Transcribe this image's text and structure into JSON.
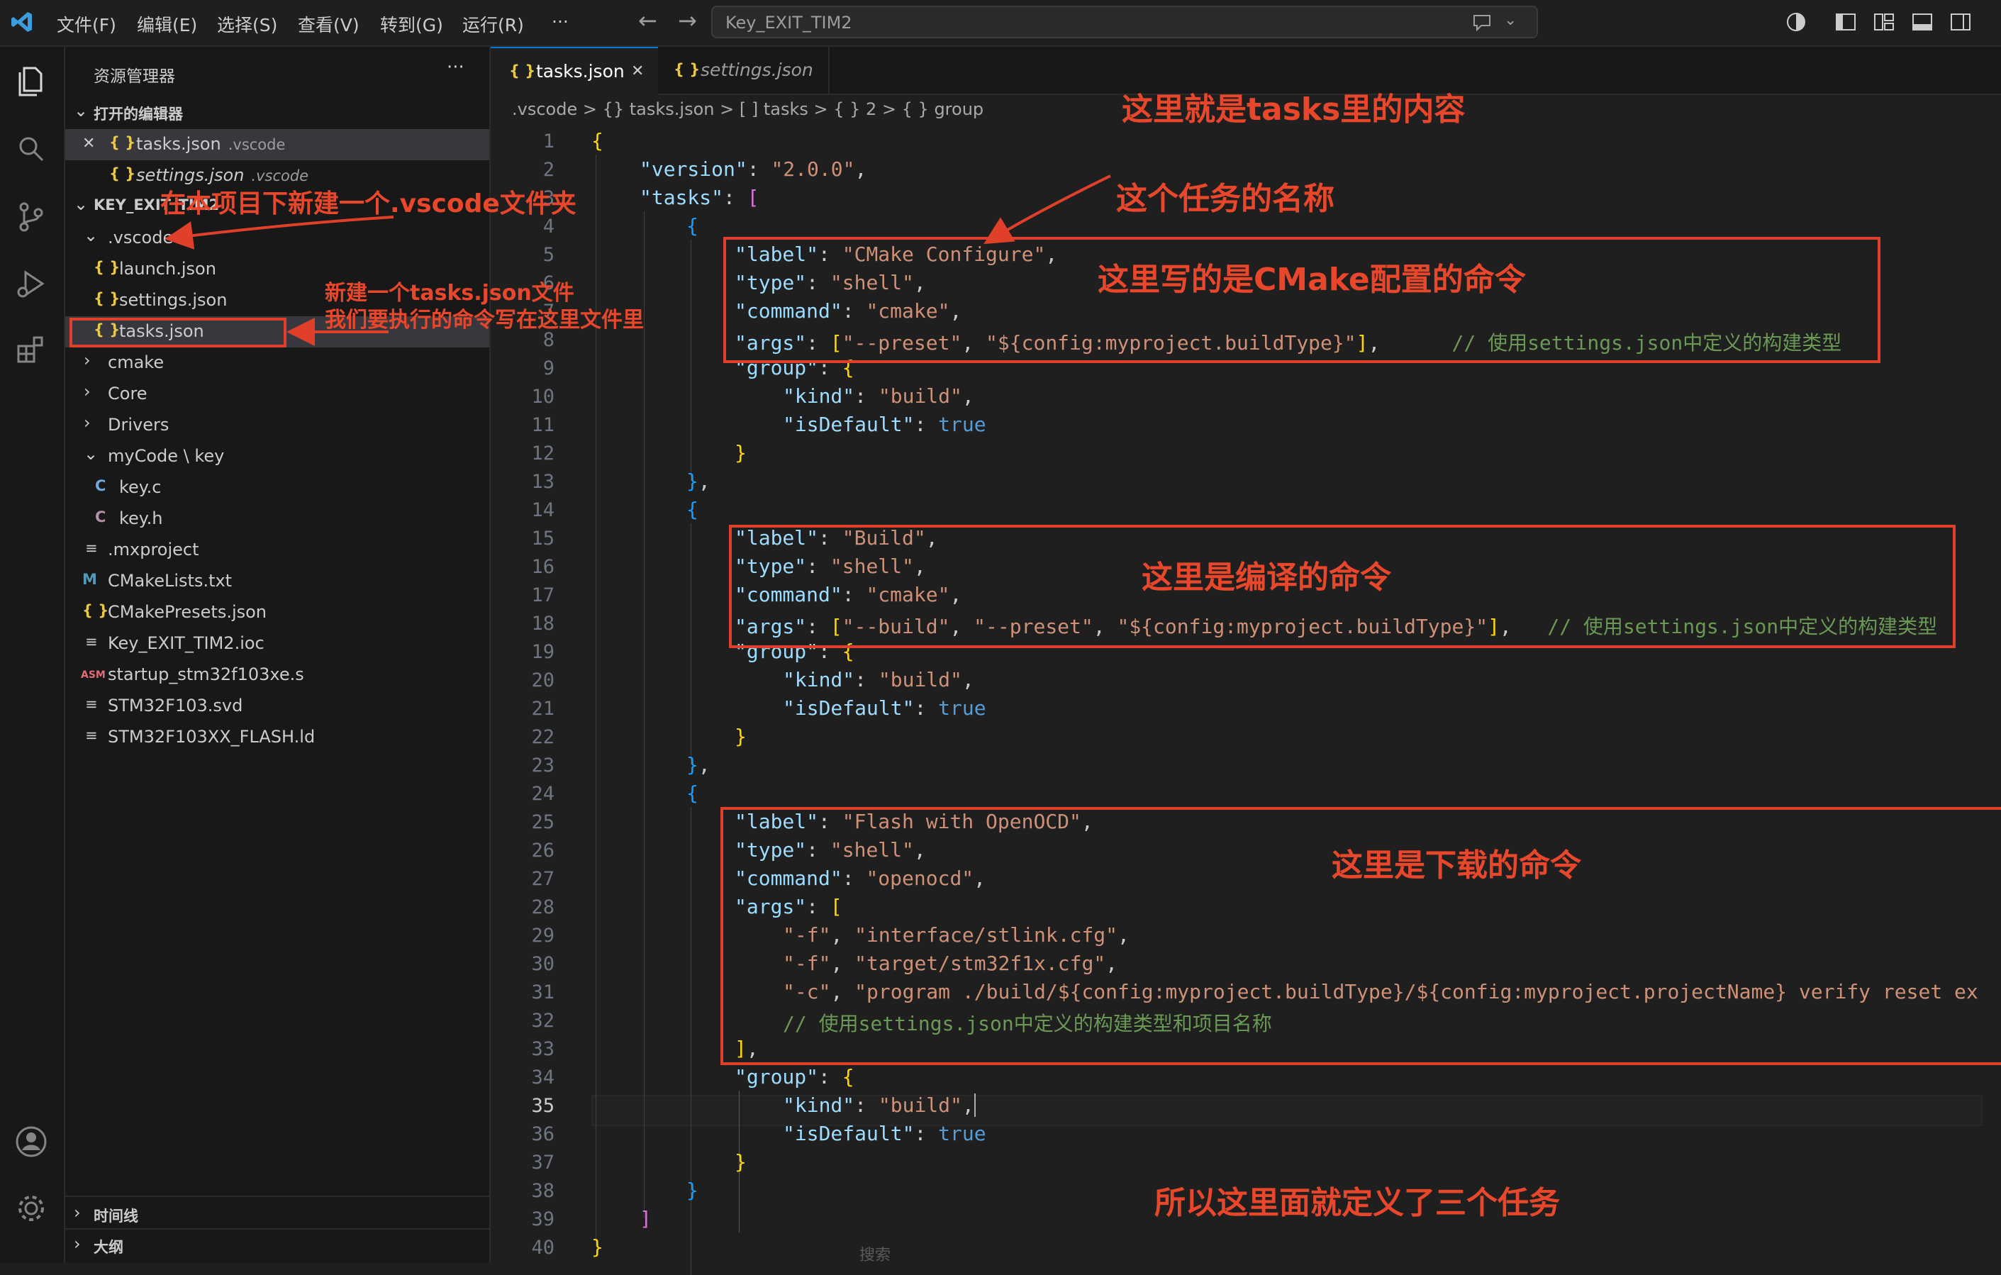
{
  "menu": [
    "文件(F)",
    "编辑(E)",
    "选择(S)",
    "查看(V)",
    "转到(G)",
    "运行(R)",
    "···"
  ],
  "command_center": "Key_EXIT_TIM2",
  "sidebar": {
    "title": "资源管理器",
    "more": "···",
    "open_editors_header": "打开的编辑器",
    "open_editors": [
      {
        "name": "tasks.json",
        "hint": ".vscode",
        "close": "✕"
      },
      {
        "name": "settings.json",
        "hint": ".vscode"
      }
    ],
    "project_header": "KEY_EXIT_TIM2",
    "tree": {
      "vscode": ".vscode",
      "launch": "launch.json",
      "settings": "settings.json",
      "tasks": "tasks.json",
      "cmake": "cmake",
      "core": "Core",
      "drivers": "Drivers",
      "mycode": "myCode \\ key",
      "keyc": "key.c",
      "keyh": "key.h",
      "mxproject": ".mxproject",
      "cmakelists": "CMakeLists.txt",
      "cmakepresets": "CMakePresets.json",
      "ioc": "Key_EXIT_TIM2.ioc",
      "startup": "startup_stm32f103xe.s",
      "svd": "STM32F103.svd",
      "ld": "STM32F103XX_FLASH.ld"
    },
    "timeline": "时间线",
    "outline": "大纲"
  },
  "tabs": [
    {
      "label": "tasks.json",
      "close": "✕"
    },
    {
      "label": "settings.json"
    }
  ],
  "breadcrumb": ".vscode  >  {} tasks.json  >  [ ] tasks  >  { } 2  >  { } group",
  "search_hint": "搜索",
  "annotations": {
    "tasks_content": "这里就是tasks里的内容",
    "task_name": "这个任务的名称",
    "cmake_config": "这里写的是CMake配置的命令",
    "compile": "这里是编译的命令",
    "download": "这里是下载的命令",
    "three_tasks": "所以这里面就定义了三个任务",
    "new_folder": "在本项目下新建一个.vscode文件夹",
    "new_file_1": "新建一个tasks.json文件",
    "new_file_2": "我们要执行的命令写在这里文件里"
  },
  "code": {
    "l2_key": "\"version\"",
    "l2_val": "\"2.0.0\"",
    "l3_key": "\"tasks\"",
    "label_key": "\"label\"",
    "type_key": "\"type\"",
    "command_key": "\"command\"",
    "args_key": "\"args\"",
    "group_key": "\"group\"",
    "kind_key": "\"kind\"",
    "isdefault_key": "\"isDefault\"",
    "t1_label": "\"CMake Configure\"",
    "shell": "\"shell\"",
    "cmake": "\"cmake\"",
    "t1_arg1": "\"--preset\"",
    "t1_arg2": "\"${config:myproject.buildType}\"",
    "t1_comment": "// 使用settings.json中定义的构建类型",
    "build": "\"build\"",
    "true": "true",
    "t2_label": "\"Build\"",
    "t2_arg1": "\"--build\"",
    "t2_arg2": "\"--preset\"",
    "t2_arg3": "\"${config:myproject.buildType}\"",
    "t2_comment": "// 使用settings.json中定义的构建类型",
    "t3_label": "\"Flash with OpenOCD\"",
    "openocd": "\"openocd\"",
    "f_flag": "\"-f\"",
    "c_flag": "\"-c\"",
    "iface": "\"interface/stlink.cfg\"",
    "target": "\"target/stm32f1x.cfg\"",
    "program": "\"program ./build/${config:myproject.buildType}/${config:myproject.projectName} verify reset ex",
    "t3_comment": "// 使用settings.json中定义的构建类型和项目名称"
  }
}
